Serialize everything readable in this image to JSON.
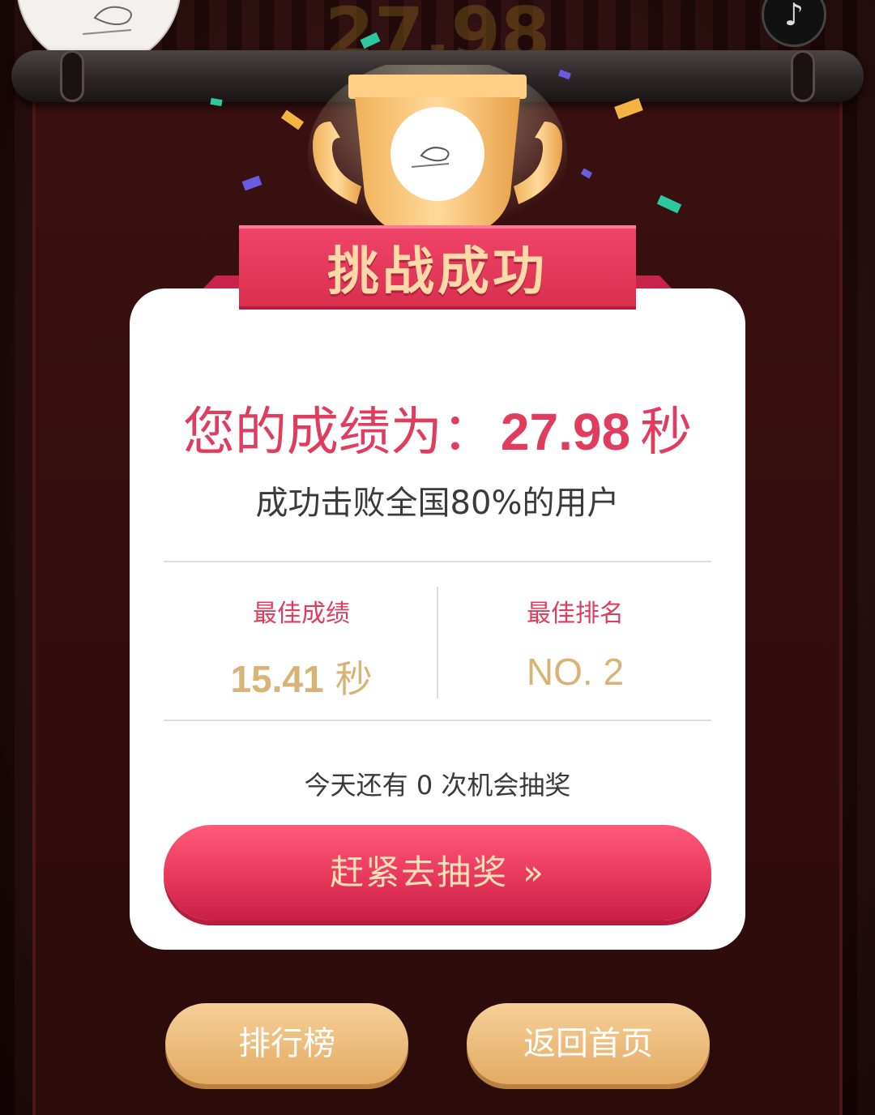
{
  "header": {
    "ghost_score": "27.98"
  },
  "banner": {
    "title": "挑战成功"
  },
  "result": {
    "prefix": "您的成绩为：",
    "score": "27.98",
    "unit": "秒",
    "beat_text": "成功击败全国80%的用户"
  },
  "stats": {
    "best_score_label": "最佳成绩",
    "best_score_value": "15.41",
    "best_score_unit": "秒",
    "best_rank_label": "最佳排名",
    "best_rank_value": "NO. 2"
  },
  "lottery": {
    "chances_text": "今天还有 0 次机会抽奖",
    "button_label": "赶紧去抽奖",
    "button_chevron": "»"
  },
  "footer": {
    "leaderboard_label": "排行榜",
    "home_label": "返回首页"
  },
  "icons": {
    "music": "♪"
  },
  "colors": {
    "accent": "#e03c5e",
    "gold": "#d9b276",
    "button_gold": "#e3ab63"
  }
}
